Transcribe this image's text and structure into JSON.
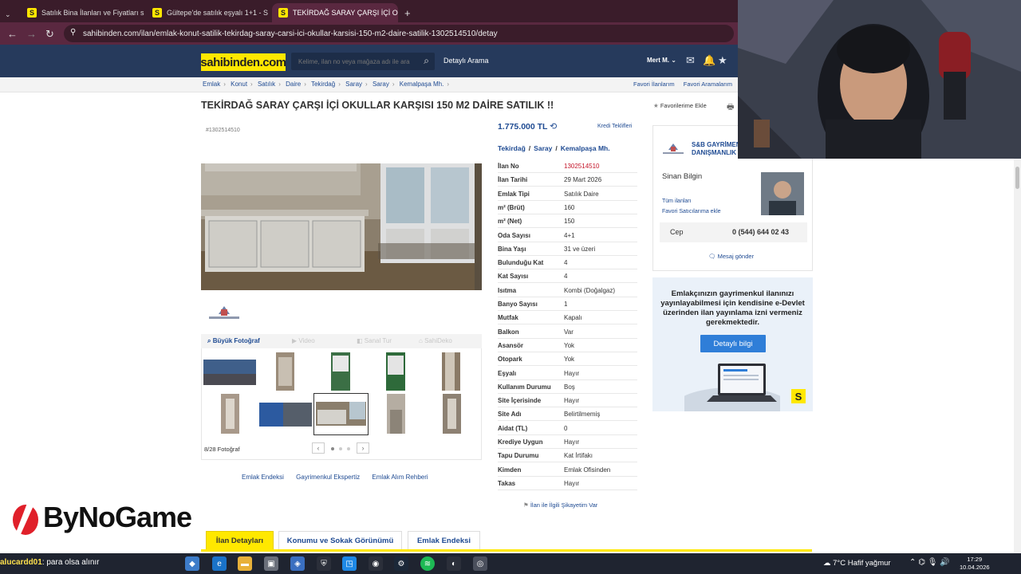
{
  "browser": {
    "tabs": [
      {
        "label": "Satılık Bina İlanları ve Fiyatları s",
        "active": false
      },
      {
        "label": "Gültepe'de satılık eşyalı 1+1 - S",
        "active": false
      },
      {
        "label": "TEKİRDAĞ SARAY ÇARŞI İÇİ OK",
        "active": true
      }
    ],
    "new_tab": "+",
    "url": "sahibinden.com/ilan/emlak-konut-satilik-tekirdag-saray-carsi-ici-okullar-karsisi-150-m2-daire-satilik-1302514510/detay"
  },
  "header": {
    "logo": "sahibinden.com",
    "search_placeholder": "Kelime, ilan no veya mağaza adı ile ara",
    "detailed_search": "Detaylı Arama",
    "user": "Mert M."
  },
  "breadcrumbs": [
    "Emlak",
    "Konut",
    "Satılık",
    "Daire",
    "Tekirdağ",
    "Saray",
    "Saray",
    "Kemalpaşa Mh."
  ],
  "fav_links": [
    "Favori İlanlarım",
    "Favori Aramalarım"
  ],
  "listing": {
    "title": "TEKİRDAĞ SARAY ÇARŞI İÇİ OKULLAR KARŞISI 150 M2 DAİRE SATILIK !!",
    "favorite_add": "Favorilerime Ekle",
    "id_label": "#1302514510",
    "price": "1.775.000 TL",
    "credit_offers": "Kredi Teklifleri",
    "location": [
      "Tekirdağ",
      "Saray",
      "Kemalpaşa Mh."
    ],
    "location_sep": "/",
    "complaint": "İlan ile İlgili Şikayetim Var"
  },
  "photos": {
    "large_photo": "Büyük Fotoğraf",
    "video": "Video",
    "virtual_tour": "Sanal Tur",
    "sahideko": "SahiDeko",
    "count": "8/28 Fotoğraf",
    "prev": "‹",
    "next": "›"
  },
  "details": [
    {
      "k": "İlan No",
      "v": "1302514510",
      "red": true
    },
    {
      "k": "İlan Tarihi",
      "v": "29 Mart 2026"
    },
    {
      "k": "Emlak Tipi",
      "v": "Satılık Daire"
    },
    {
      "k": "m² (Brüt)",
      "v": "160"
    },
    {
      "k": "m² (Net)",
      "v": "150"
    },
    {
      "k": "Oda Sayısı",
      "v": "4+1"
    },
    {
      "k": "Bina Yaşı",
      "v": "31 ve üzeri"
    },
    {
      "k": "Bulunduğu Kat",
      "v": "4"
    },
    {
      "k": "Kat Sayısı",
      "v": "4"
    },
    {
      "k": "Isıtma",
      "v": "Kombi (Doğalgaz)"
    },
    {
      "k": "Banyo Sayısı",
      "v": "1"
    },
    {
      "k": "Mutfak",
      "v": "Kapalı"
    },
    {
      "k": "Balkon",
      "v": "Var"
    },
    {
      "k": "Asansör",
      "v": "Yok"
    },
    {
      "k": "Otopark",
      "v": "Yok"
    },
    {
      "k": "Eşyalı",
      "v": "Hayır"
    },
    {
      "k": "Kullanım Durumu",
      "v": "Boş"
    },
    {
      "k": "Site İçerisinde",
      "v": "Hayır"
    },
    {
      "k": "Site Adı",
      "v": "Belirtilmemiş"
    },
    {
      "k": "Aidat (TL)",
      "v": "0"
    },
    {
      "k": "Krediye Uygun",
      "v": "Hayır"
    },
    {
      "k": "Tapu Durumu",
      "v": "Kat İrtifakı"
    },
    {
      "k": "Kimden",
      "v": "Emlak Ofisinden"
    },
    {
      "k": "Takas",
      "v": "Hayır"
    }
  ],
  "seller": {
    "agency_line1": "S&B GAYRİMEN",
    "agency_line2": "DANIŞMANLIK",
    "person": "Sinan Bilgin",
    "all_listings": "Tüm ilanları",
    "add_fav_seller": "Favori Satıcılarıma ekle",
    "phone_label": "Cep",
    "phone": "0 (544) 644 02 43",
    "message": "Mesaj gönder"
  },
  "ad": {
    "text": "Emlakçınızın gayrimenkul ilanınızı yayınlayabilmesi için kendisine e-Devlet üzerinden ilan yayınlama izni vermeniz gerekmektedir.",
    "button": "Detaylı bilgi",
    "logo": "S"
  },
  "lower_links": [
    "Emlak Endeksi",
    "Gayrimenkul Ekspertiz",
    "Emlak Alım Rehberi"
  ],
  "bottom_tabs": [
    {
      "label": "İlan Detayları",
      "active": true
    },
    {
      "label": "Konumu ve Sokak Görünümü",
      "active": false
    },
    {
      "label": "Emlak Endeksi",
      "active": false
    }
  ],
  "overlay": {
    "brand": "ByNoGame",
    "chat_user": "alucardd01",
    "chat_text": ": para olsa alınır"
  },
  "taskbar": {
    "weather": "7°C  Hafif yağmur",
    "time": "17:29",
    "date": "10.04.2026"
  },
  "colors": {
    "header": "#263a5c",
    "accent": "#ffe800",
    "link": "#1e4a92",
    "browser_frame": "#3a1c2a"
  }
}
